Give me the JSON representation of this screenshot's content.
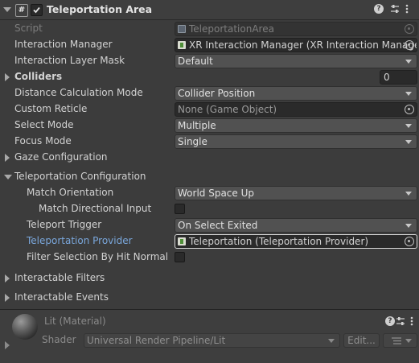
{
  "header": {
    "component_icon": "script-component-icon",
    "component_glyph": "#",
    "title": "Teleportation Area",
    "enabled": true,
    "icons": [
      "help-icon",
      "presets-icon",
      "more-menu-icon"
    ]
  },
  "properties": {
    "script": {
      "label": "Script",
      "value": "TeleportationArea"
    },
    "interaction_manager": {
      "label": "Interaction Manager",
      "value": "XR Interaction Manager (XR Interaction Manage"
    },
    "interaction_layer_mask": {
      "label": "Interaction Layer Mask",
      "value": "Default"
    },
    "colliders": {
      "label": "Colliders",
      "value": "0"
    },
    "distance_calc_mode": {
      "label": "Distance Calculation Mode",
      "value": "Collider Position"
    },
    "custom_reticle": {
      "label": "Custom Reticle",
      "value": "None (Game Object)"
    },
    "select_mode": {
      "label": "Select Mode",
      "value": "Multiple"
    },
    "focus_mode": {
      "label": "Focus Mode",
      "value": "Single"
    },
    "gaze_configuration": {
      "label": "Gaze Configuration"
    },
    "teleportation_configuration": {
      "label": "Teleportation Configuration",
      "match_orientation": {
        "label": "Match Orientation",
        "value": "World Space Up"
      },
      "match_directional_input": {
        "label": "Match Directional Input",
        "checked": false
      },
      "teleport_trigger": {
        "label": "Teleport Trigger",
        "value": "On Select Exited"
      },
      "teleportation_provider": {
        "label": "Teleportation Provider",
        "value": "Teleportation (Teleportation Provider)"
      },
      "filter_selection": {
        "label": "Filter Selection By Hit Normal",
        "checked": false
      }
    },
    "interactable_filters": {
      "label": "Interactable Filters"
    },
    "interactable_events": {
      "label": "Interactable Events"
    }
  },
  "material": {
    "name": "Lit (Material)",
    "shader_label": "Shader",
    "shader_value": "Universal Render Pipeline/Lit",
    "edit_label": "Edit...",
    "list_icon": "list-icon"
  },
  "colors": {
    "background": "#3c3c3c",
    "field": "#2a2a2a",
    "dropdown": "#515151",
    "highlight_label": "#7aa7dc"
  }
}
